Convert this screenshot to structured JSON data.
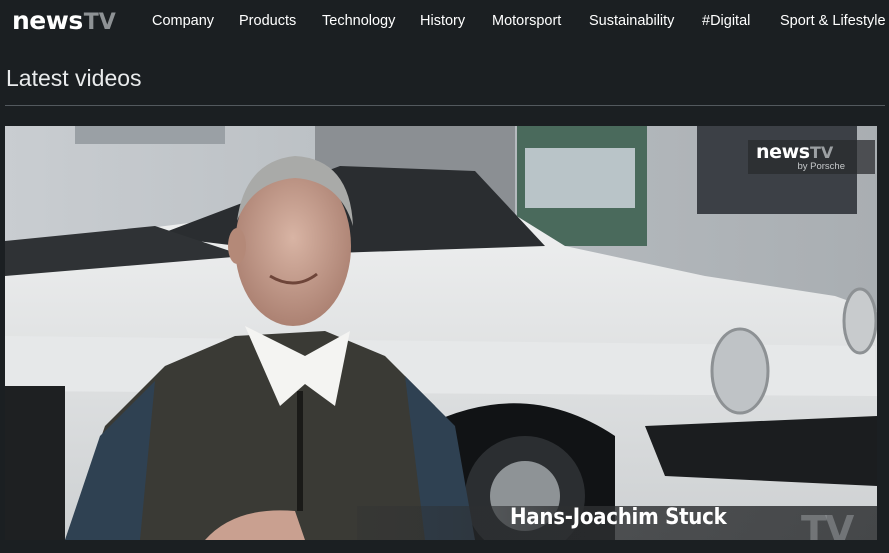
{
  "header": {
    "logo": {
      "news": "news",
      "tv": "TV"
    },
    "nav": [
      {
        "label": "Company"
      },
      {
        "label": "Products"
      },
      {
        "label": "Technology"
      },
      {
        "label": "History"
      },
      {
        "label": "Motorsport"
      },
      {
        "label": "Sustainability"
      },
      {
        "label": "#Digital"
      },
      {
        "label": "Sport & Lifestyle"
      }
    ]
  },
  "section": {
    "title": "Latest videos"
  },
  "video": {
    "watermark": {
      "news": "news",
      "tv": "TV",
      "by": "by Porsche"
    },
    "caption": {
      "name": "Hans-Joachim Stuck"
    },
    "corner_mark": "TV"
  }
}
